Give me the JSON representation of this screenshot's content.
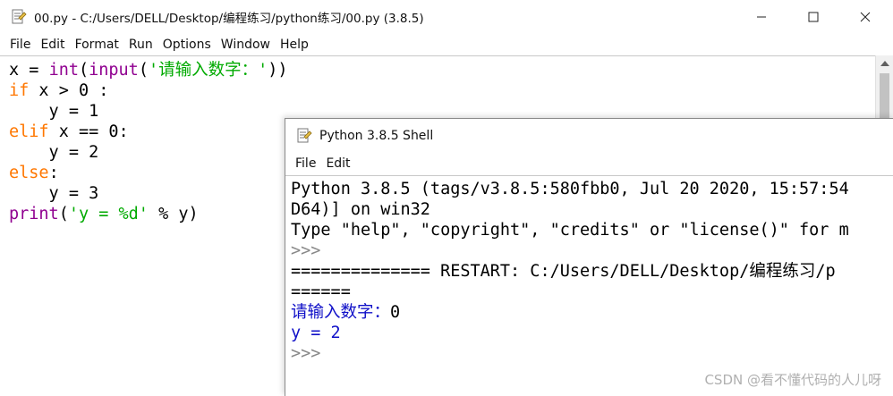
{
  "editor": {
    "title": "00.py - C:/Users/DELL/Desktop/编程练习/python练习/00.py (3.8.5)",
    "menu": [
      "File",
      "Edit",
      "Format",
      "Run",
      "Options",
      "Window",
      "Help"
    ],
    "code": [
      [
        {
          "t": "x = ",
          "c": "nm"
        },
        {
          "t": "int",
          "c": "bi"
        },
        {
          "t": "(",
          "c": "nm"
        },
        {
          "t": "input",
          "c": "bi"
        },
        {
          "t": "(",
          "c": "nm"
        },
        {
          "t": "'请输入数字：'",
          "c": "str"
        },
        {
          "t": "))",
          "c": "nm"
        }
      ],
      [
        {
          "t": "if",
          "c": "kw"
        },
        {
          "t": " x > 0 :",
          "c": "nm"
        }
      ],
      [
        {
          "t": "    y = 1",
          "c": "nm"
        }
      ],
      [
        {
          "t": "elif",
          "c": "kw"
        },
        {
          "t": " x == 0:",
          "c": "nm"
        }
      ],
      [
        {
          "t": "    y = 2",
          "c": "nm"
        }
      ],
      [
        {
          "t": "else",
          "c": "kw"
        },
        {
          "t": ":",
          "c": "nm"
        }
      ],
      [
        {
          "t": "    y = 3",
          "c": "nm"
        }
      ],
      [
        {
          "t": "print",
          "c": "bi"
        },
        {
          "t": "(",
          "c": "nm"
        },
        {
          "t": "'y = %d'",
          "c": "str"
        },
        {
          "t": " % y)",
          "c": "nm"
        }
      ]
    ]
  },
  "shell": {
    "title": "Python 3.8.5 Shell",
    "menu": [
      "File",
      "Edit"
    ],
    "lines": [
      {
        "t": "Python 3.8.5 (tags/v3.8.5:580fbb0, Jul 20 2020, 15:57:54",
        "c": "out"
      },
      {
        "t": "D64)] on win32",
        "c": "out"
      },
      {
        "t": "Type \"help\", \"copyright\", \"credits\" or \"license()\" for m",
        "c": "out"
      },
      {
        "t": ">>>",
        "c": "prompt"
      },
      {
        "t": "============== RESTART: C:/Users/DELL/Desktop/编程练习/p",
        "c": "out"
      },
      {
        "t": "======",
        "c": "out"
      },
      {
        "t": "请输入数字：",
        "c": "stdout",
        "extra": {
          "t": "0",
          "c": "out"
        }
      },
      {
        "t": "y = 2",
        "c": "stdout"
      },
      {
        "t": ">>>",
        "c": "prompt"
      }
    ]
  },
  "watermark": "CSDN @看不懂代码的人儿呀",
  "colors": {
    "keyword": "#ff7700",
    "builtin": "#900090",
    "string": "#00aa00",
    "stdout": "#1010c8",
    "prompt": "#888888"
  }
}
